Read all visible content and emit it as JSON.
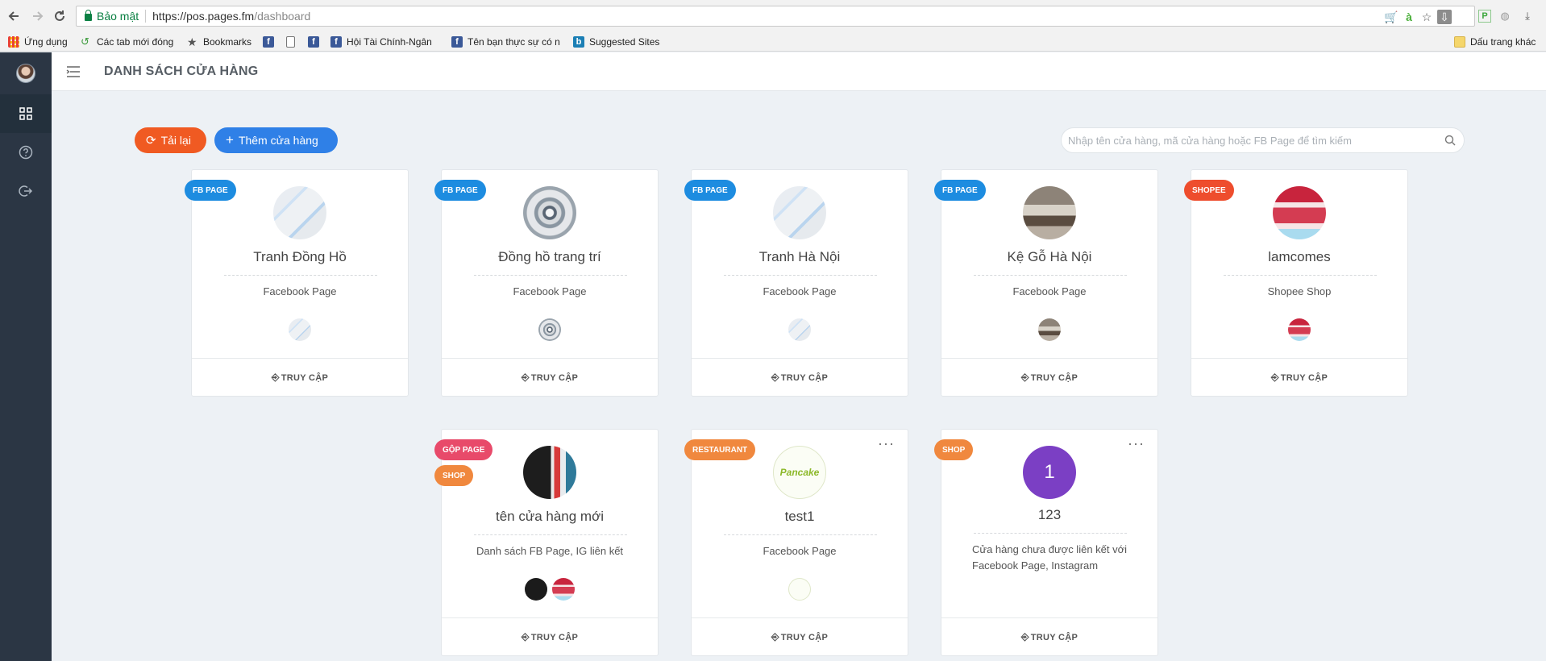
{
  "browser": {
    "security_label": "Bảo mật",
    "url_base": "https://pos.pages.fm",
    "url_path": "/dashboard"
  },
  "bookmarks": [
    {
      "label": "Ứng dụng",
      "icon": "apps-icon"
    },
    {
      "label": "Các tab mới đóng",
      "icon": "history-icon"
    },
    {
      "label": "Bookmarks",
      "icon": "star-icon"
    },
    {
      "label": "",
      "icon": "facebook-icon"
    },
    {
      "label": "",
      "icon": "page-icon"
    },
    {
      "label": "",
      "icon": "facebook-icon"
    },
    {
      "label": "Hội Tài Chính-Ngân",
      "icon": "facebook-icon"
    },
    {
      "label": "Tên bạn thực sự có n",
      "icon": "facebook-icon"
    },
    {
      "label": "Suggested Sites",
      "icon": "bing-icon"
    },
    {
      "label": "Dấu trang khác",
      "icon": "folder-icon"
    }
  ],
  "header": {
    "title": "DANH SÁCH CỬA HÀNG"
  },
  "actions": {
    "reload": "Tải lại",
    "add_store": "Thêm cửa hàng",
    "search_placeholder": "Nhập tên cửa hàng, mã cửa hàng hoặc FB Page để tìm kiếm"
  },
  "colors": {
    "sidebar": "#2b3644",
    "reload": "#f05a22",
    "add_store": "#2f80e7",
    "fb_badge": "#1d8ce0",
    "shopee_badge": "#ee4d2d",
    "group_badge": "#e84a6a",
    "shop_badge": "#f0883e",
    "number_avatar": "#7b3fc4"
  },
  "stores": [
    {
      "badge": "FB PAGE",
      "name": "Tranh Đồng Hồ",
      "type": "Facebook Page",
      "access": "TRUY CẬP"
    },
    {
      "badge": "FB PAGE",
      "name": "Đồng hồ trang trí",
      "type": "Facebook Page",
      "access": "TRUY CẬP"
    },
    {
      "badge": "FB PAGE",
      "name": "Tranh Hà Nội",
      "type": "Facebook Page",
      "access": "TRUY CẬP"
    },
    {
      "badge": "FB PAGE",
      "name": "Kệ Gỗ Hà Nội",
      "type": "Facebook Page",
      "access": "TRUY CẬP"
    },
    {
      "badge": "SHOPEE",
      "name": "lamcomes",
      "type": "Shopee Shop",
      "access": "TRUY CẬP"
    },
    {
      "badge": "GỘP PAGE",
      "badge2": "SHOP",
      "name": "tên cửa hàng mới",
      "type": "Danh sách FB Page, IG liên kết",
      "access": "TRUY CẬP"
    },
    {
      "badge": "RESTAURANT",
      "name": "test1",
      "type": "Facebook Page",
      "avatar_text": "Pancake",
      "more": "···",
      "access": "TRUY CẬP"
    },
    {
      "badge": "SHOP",
      "name": "123",
      "avatar_text": "1",
      "note": "Cửa hàng chưa được liên kết với Facebook Page, Instagram",
      "more": "···",
      "access": "TRUY CẬP"
    }
  ]
}
